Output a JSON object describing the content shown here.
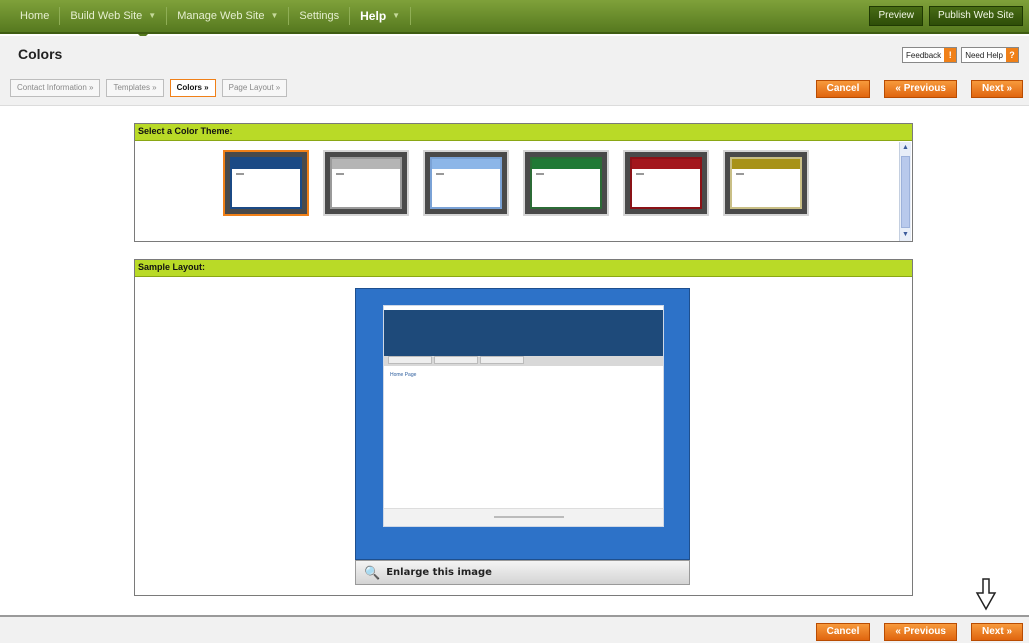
{
  "nav": {
    "items": [
      {
        "label": "Home",
        "caret": false
      },
      {
        "label": "Build Web Site",
        "caret": true
      },
      {
        "label": "Manage Web Site",
        "caret": true
      },
      {
        "label": "Settings",
        "caret": false
      },
      {
        "label": "Help",
        "caret": true
      }
    ],
    "active": "Help",
    "preview_label": "Preview",
    "publish_label": "Publish Web Site"
  },
  "page": {
    "title": "Colors",
    "feedback_label": "Feedback",
    "need_help_label": "Need Help"
  },
  "wizard": {
    "steps": [
      "Contact Information »",
      "Templates »",
      "Colors »",
      "Page Layout »"
    ],
    "current_step": 2,
    "cancel_label": "Cancel",
    "previous_label": "« Previous",
    "next_label": "Next »"
  },
  "themes_panel": {
    "heading": "Select a Color Theme:",
    "themes": [
      {
        "name": "dark-blue",
        "band": "#1b4a85",
        "border": "#1b4a85",
        "selected": true
      },
      {
        "name": "gray",
        "band": "#b5b5b5",
        "border": "#9a9a9a",
        "selected": false
      },
      {
        "name": "light-blue",
        "band": "#8cb6e8",
        "border": "#7aa2d6",
        "selected": false
      },
      {
        "name": "green",
        "band": "#1f7a35",
        "border": "#2c6b36",
        "selected": false
      },
      {
        "name": "red",
        "band": "#a3161c",
        "border": "#8a1217",
        "selected": false
      },
      {
        "name": "olive",
        "band": "#a89218",
        "border": "#c9bf86",
        "selected": false
      }
    ]
  },
  "sample_panel": {
    "heading": "Sample Layout:",
    "preview_link": "Home Page",
    "enlarge_label": "Enlarge this image"
  },
  "bottom": {
    "cancel_label": "Cancel",
    "previous_label": "« Previous",
    "next_label": "Next »"
  },
  "colors": {
    "nav_green": "#56791f",
    "accent_orange": "#f08018",
    "panel_lime": "#b9da27",
    "preview_blue": "#2d72c8"
  }
}
